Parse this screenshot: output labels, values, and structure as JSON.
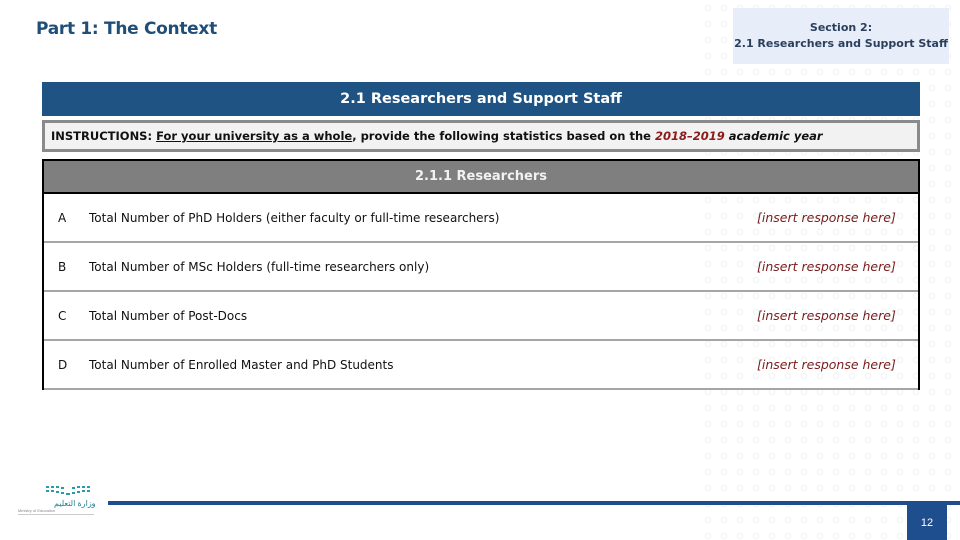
{
  "page": {
    "part_title": "Part 1: The Context",
    "section_box": {
      "line1": "Section 2:",
      "line2": "2.1 Researchers and Support Staff"
    },
    "header": "2.1 Researchers and Support Staff",
    "instructions": {
      "prefix": "INSTRUCTIONS:",
      "underlined": "For your university as a whole",
      "middle": ", provide the following statistics based on the",
      "year": "2018–2019",
      "suffix": "academic year"
    },
    "table": {
      "title": "2.1.1 Researchers",
      "rows": [
        {
          "letter": "A",
          "label": "Total Number of PhD Holders (either faculty or full-time researchers)",
          "response": "[insert response here]"
        },
        {
          "letter": "B",
          "label": "Total Number of MSc Holders (full-time researchers only)",
          "response": "[insert response here]"
        },
        {
          "letter": "C",
          "label": "Total Number of Post-Docs",
          "response": "[insert response here]"
        },
        {
          "letter": "D",
          "label": "Total Number of Enrolled Master and PhD Students",
          "response": "[insert response here]"
        }
      ]
    },
    "page_number": "12",
    "logo": {
      "arabic": "وزارة التعليم",
      "english": "Ministry of Education"
    }
  },
  "colors": {
    "title_blue": "#1f4e79",
    "header_blue": "#1f5383",
    "section_bg": "#e8eef9",
    "table_head_gray": "#7f7f7f",
    "response_red": "#7a1b1b",
    "footer_blue": "#1f4e8f"
  }
}
